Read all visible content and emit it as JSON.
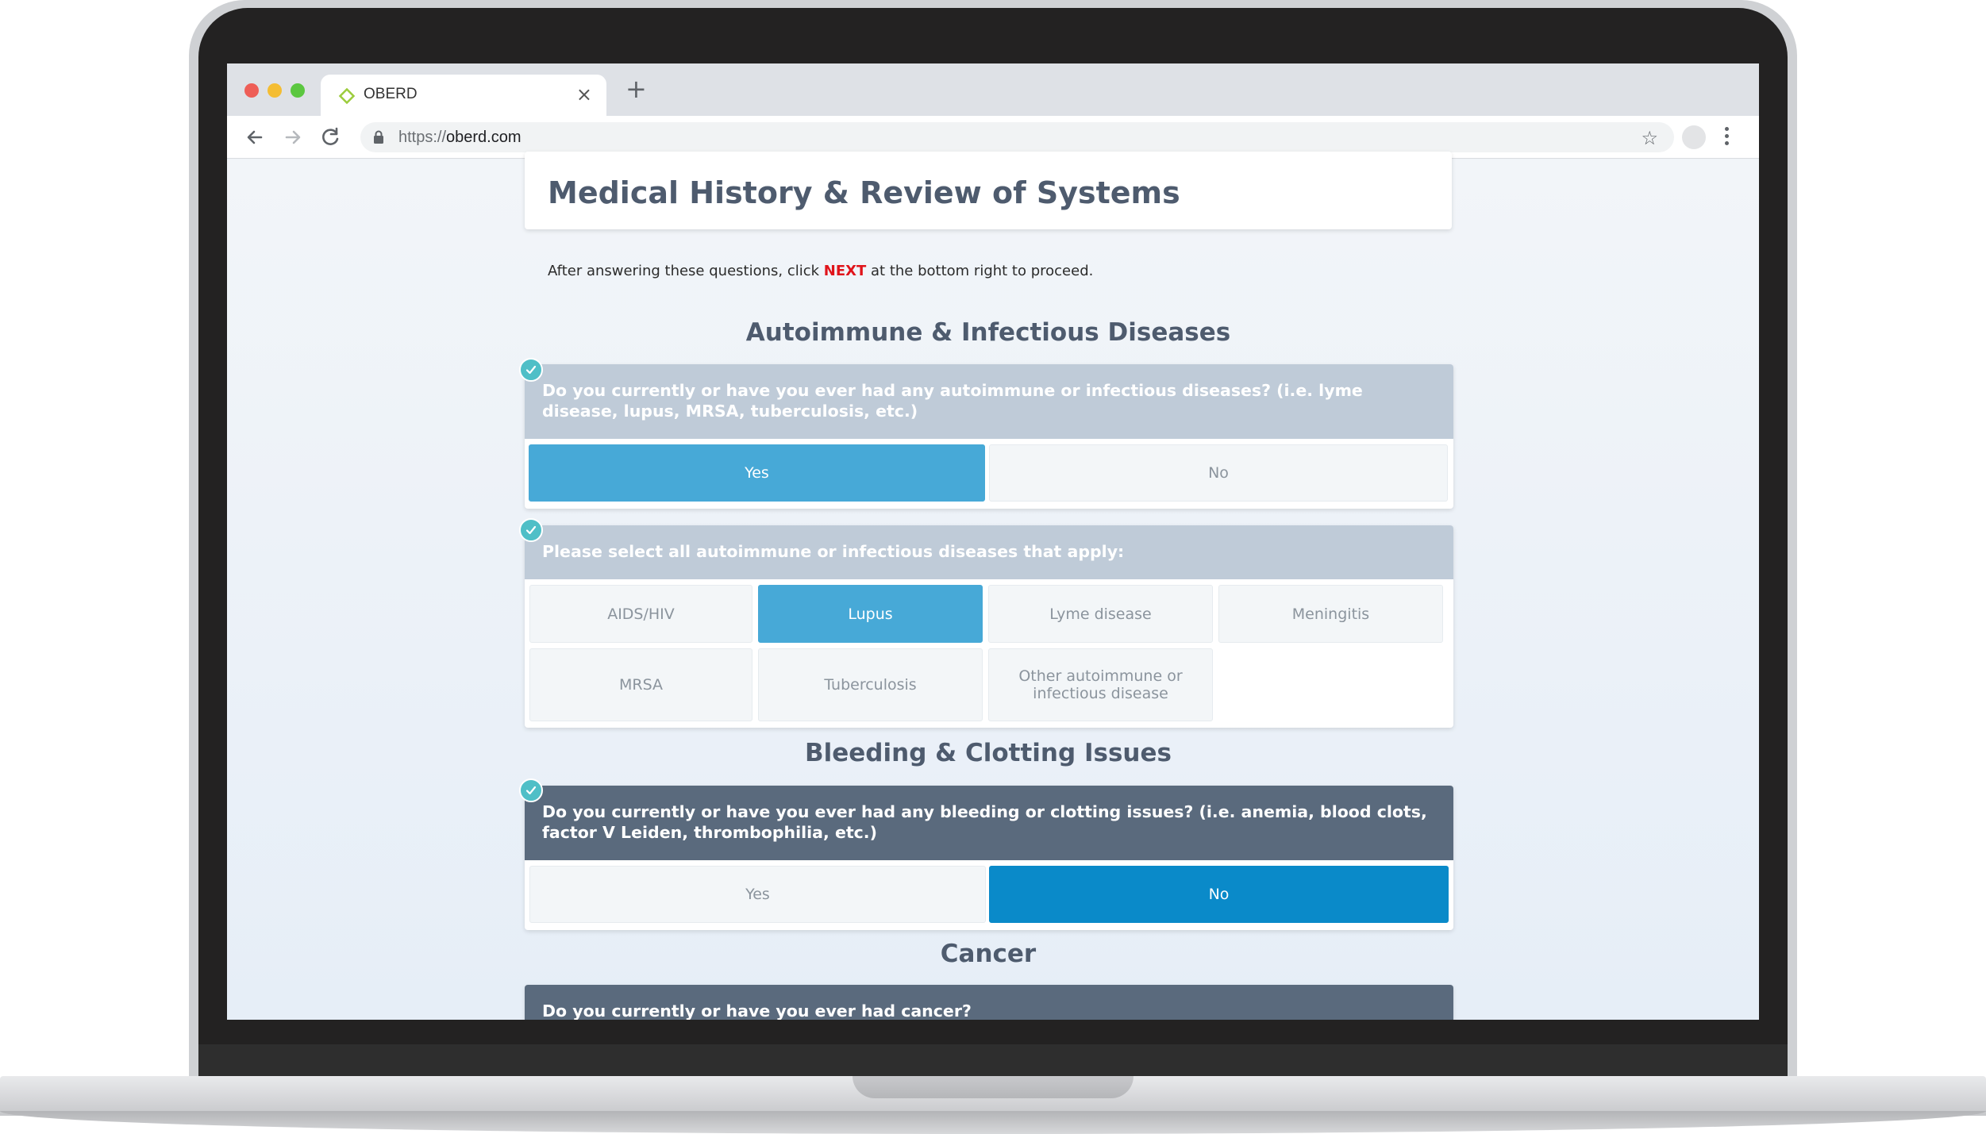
{
  "browser": {
    "tab_title": "OBERD",
    "url_scheme": "https://",
    "url_host": "oberd.com",
    "new_tab_symbol": "+",
    "close_symbol": "×",
    "star_symbol": "☆"
  },
  "page": {
    "title": "Medical History & Review of Systems",
    "instructions_before": "After answering these questions, click ",
    "instructions_next": "NEXT",
    "instructions_after": " at the bottom right to proceed."
  },
  "sections": {
    "autoimmune": {
      "heading": "Autoimmune & Infectious Diseases",
      "q1": {
        "text": "Do you currently or have you ever had any autoimmune or infectious diseases? (i.e. lyme disease, lupus, MRSA, tuberculosis, etc.)",
        "yes": "Yes",
        "no": "No",
        "selected": "Yes"
      },
      "q2": {
        "text": "Please select all autoimmune or infectious diseases that apply:",
        "options": [
          "AIDS/HIV",
          "Lupus",
          "Lyme disease",
          "Meningitis",
          "MRSA",
          "Tuberculosis",
          "Other autoimmune or infectious disease"
        ],
        "selected": [
          "Lupus"
        ]
      }
    },
    "bleeding": {
      "heading": "Bleeding & Clotting Issues",
      "q1": {
        "text": "Do you currently or have you ever had any bleeding or clotting issues? (i.e. anemia, blood clots, factor V Leiden, thrombophilia, etc.)",
        "yes": "Yes",
        "no": "No",
        "selected": "No"
      }
    },
    "cancer": {
      "heading": "Cancer",
      "q1": {
        "text": "Do you currently or have you ever had cancer?"
      }
    }
  },
  "colors": {
    "heading": "#4e5b6e",
    "question_light": "#bfcbd8",
    "question_dark": "#5a6a7d",
    "selected_light": "#47a9d7",
    "selected_dark": "#0a8ac9",
    "check": "#4fbfc7",
    "next_red": "#e0141b"
  }
}
